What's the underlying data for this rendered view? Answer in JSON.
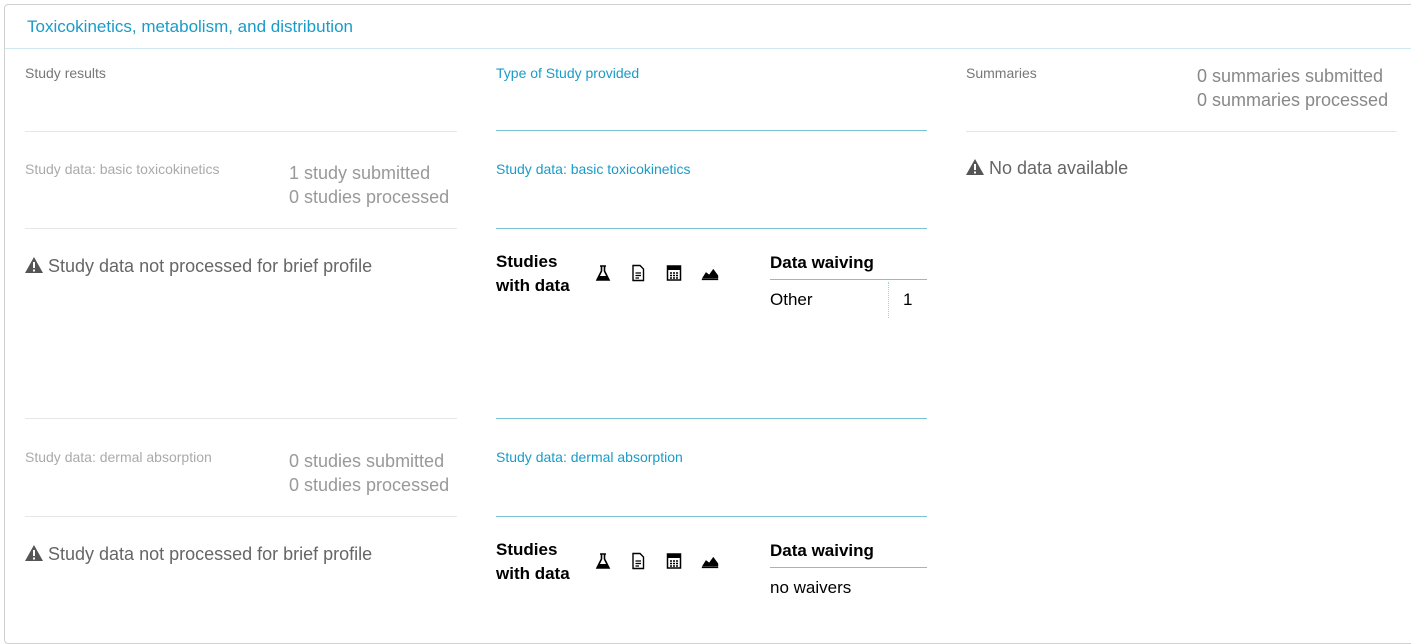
{
  "panel": {
    "title": "Toxicokinetics, metabolism, and distribution"
  },
  "columns": {
    "study_results": "Study results",
    "type_of_study": "Type of Study provided",
    "summaries": "Summaries"
  },
  "summaries": {
    "submitted": "0 summaries submitted",
    "processed": "0 summaries processed",
    "no_data": "No data available"
  },
  "sections": [
    {
      "left_label": "Study data: basic toxicokinetics",
      "submitted": "1 study submitted",
      "processed": "0 studies processed",
      "not_processed": "Study data not processed for brief profile",
      "type_label": "Study data: basic toxicokinetics",
      "studies_with_data": [
        "Studies",
        "with data"
      ],
      "icons": [
        "flask-icon",
        "document-icon",
        "calculator-icon",
        "area-chart-icon"
      ],
      "data_waiving_label": "Data waiving",
      "waiving": {
        "label": "Other",
        "count": "1"
      }
    },
    {
      "left_label": "Study data: dermal absorption",
      "submitted": "0 studies submitted",
      "processed": "0 studies processed",
      "not_processed": "Study data not processed for brief profile",
      "type_label": "Study data: dermal absorption",
      "studies_with_data": [
        "Studies",
        "with data"
      ],
      "icons": [
        "flask-icon",
        "document-icon",
        "calculator-icon",
        "area-chart-icon"
      ],
      "data_waiving_label": "Data waiving",
      "waiving_text": "no waivers"
    }
  ],
  "colors": {
    "accent": "#1a9bc8",
    "divider": "#7cc4d3"
  }
}
